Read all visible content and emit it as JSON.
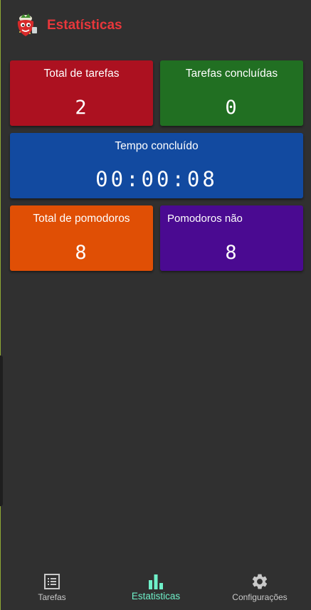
{
  "header": {
    "title": "Estatísticas",
    "logo_icon": "strawberry-mascot-icon",
    "title_color": "#e8373b"
  },
  "stats": {
    "total_tarefas": {
      "label": "Total de tarefas",
      "value": "2",
      "color": "#ac1120"
    },
    "tarefas_concluidas": {
      "label": "Tarefas concluídas",
      "value": "0",
      "color": "#216f22"
    },
    "tempo_concluido": {
      "label": "Tempo concluído",
      "value": "00:00:08",
      "color": "#124aa0"
    },
    "total_pomodoros": {
      "label": "Total de pomodoros",
      "value": "8",
      "color": "#e04f05"
    },
    "pomodoros_nao": {
      "label": "Pomodoros não",
      "value": "8",
      "color": "#4a0a91"
    }
  },
  "bottom_nav": {
    "items": [
      {
        "label": "Tarefas",
        "icon": "list-icon",
        "active": false
      },
      {
        "label": "Estatisticas",
        "icon": "bar-chart-icon",
        "active": true
      },
      {
        "label": "Configurações",
        "icon": "gear-icon",
        "active": false
      }
    ],
    "active_color": "#6ff0c9"
  }
}
